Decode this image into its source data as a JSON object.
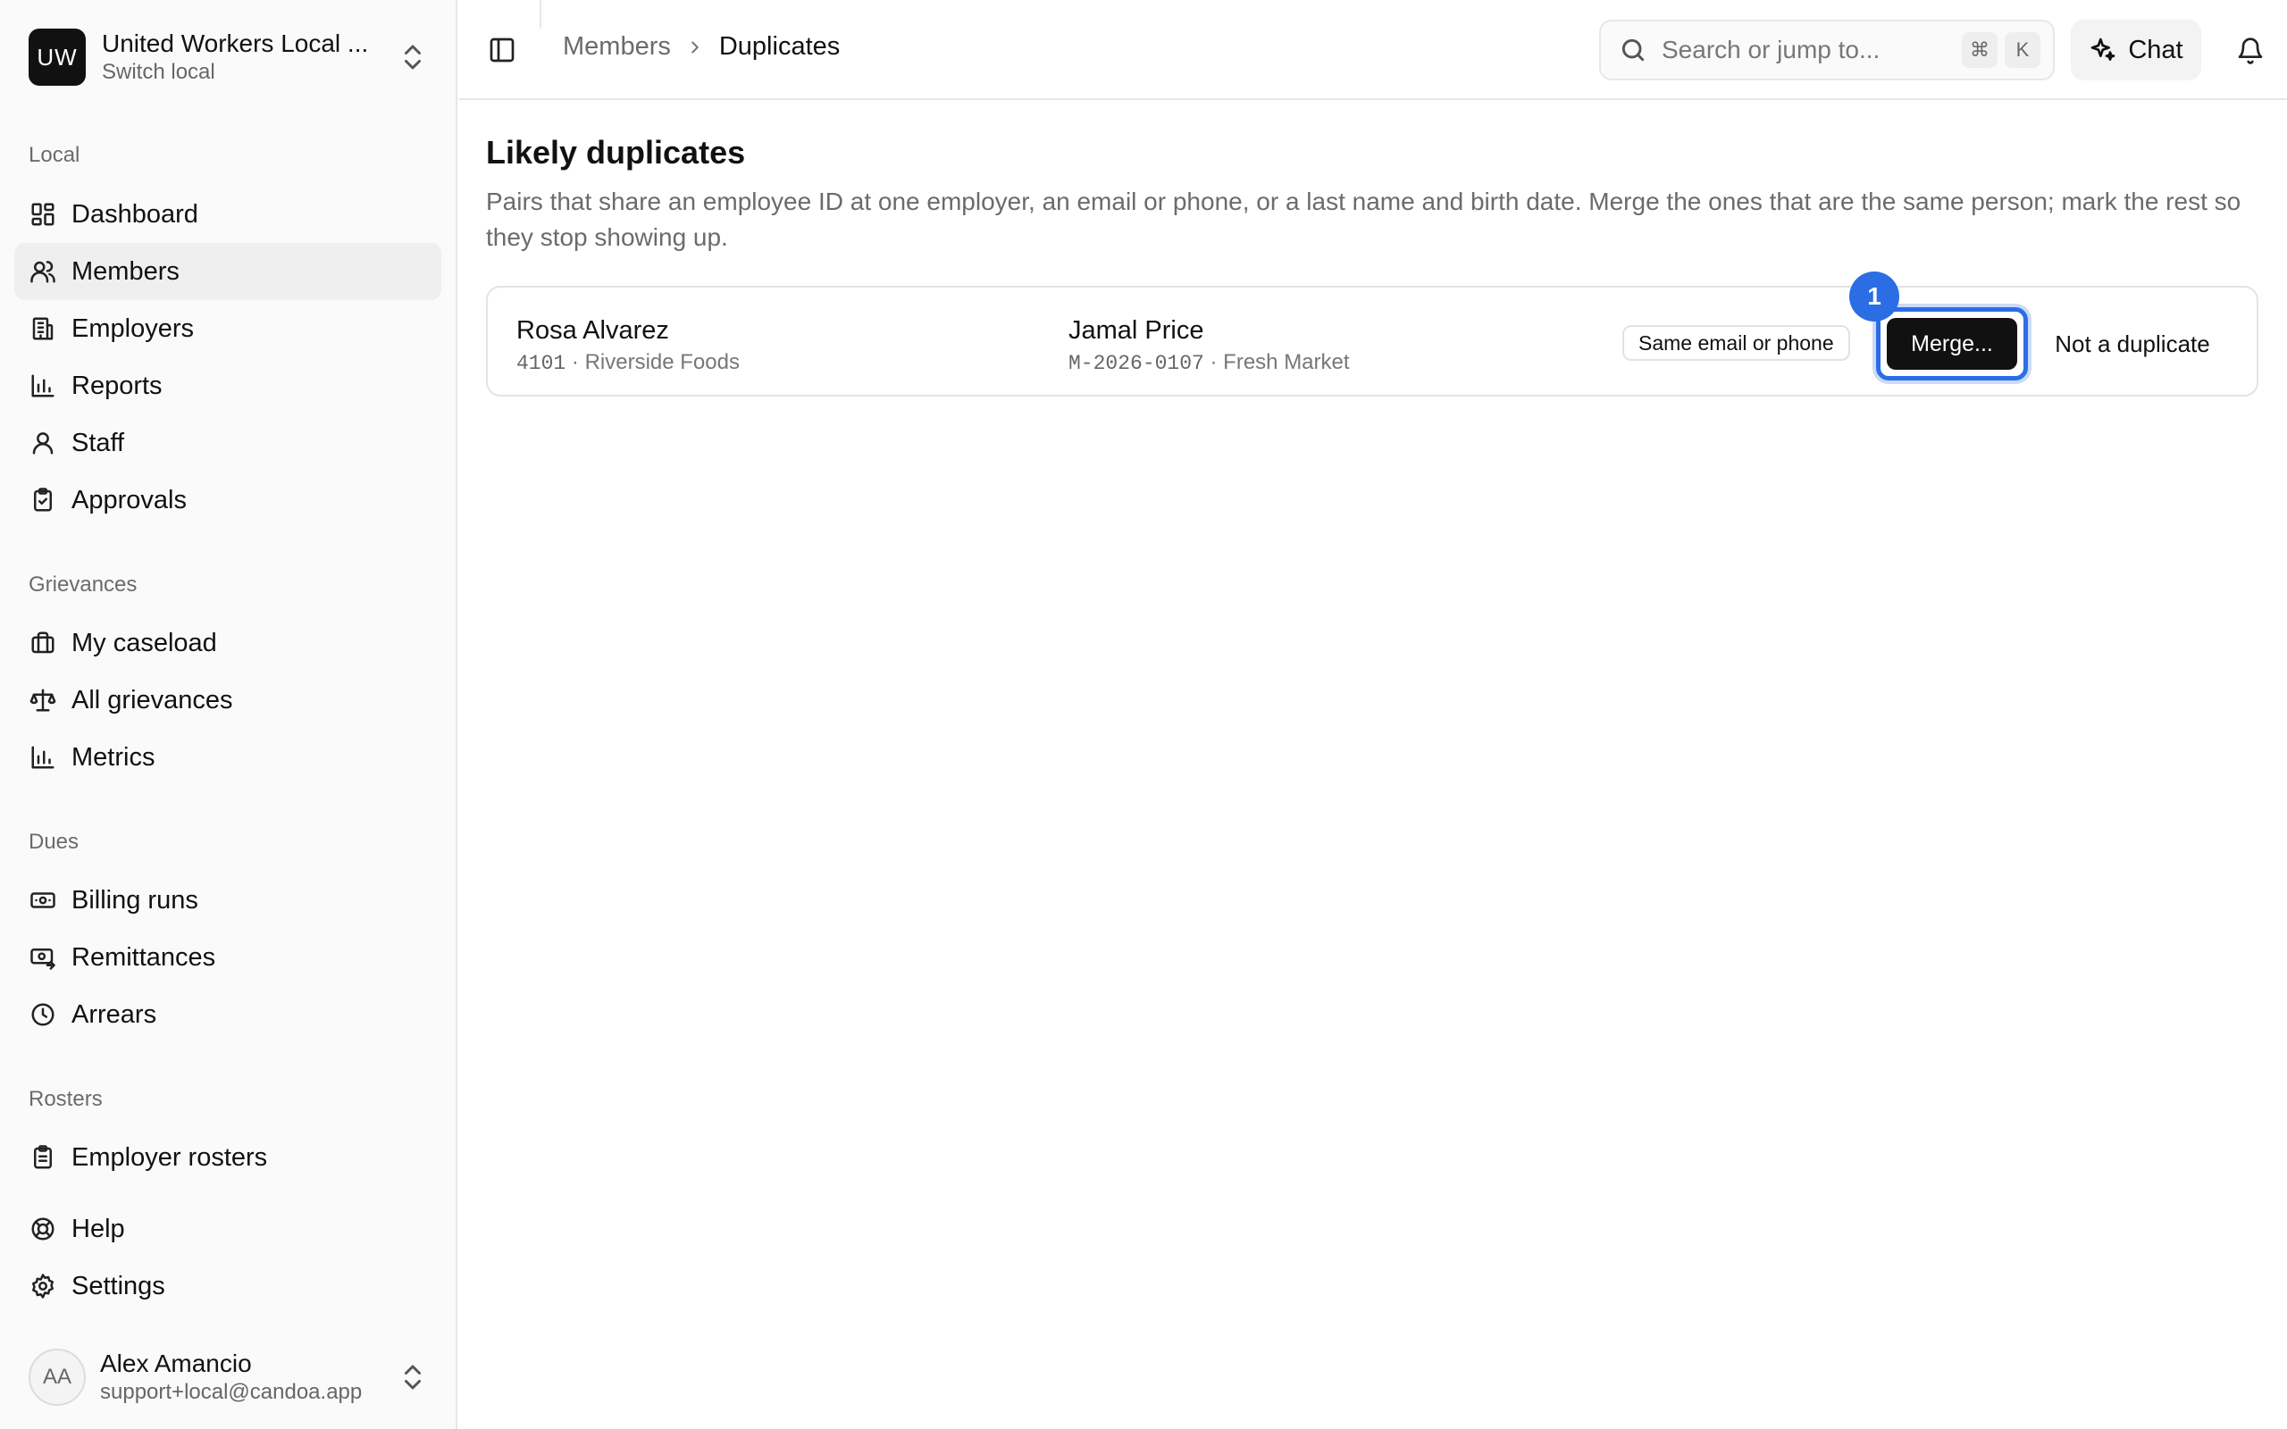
{
  "org": {
    "badge": "UW",
    "name": "United Workers Local ...",
    "sub": "Switch local"
  },
  "sidebar": {
    "sections": [
      {
        "label": "Local",
        "items": [
          {
            "label": "Dashboard",
            "icon": "dashboard-icon"
          },
          {
            "label": "Members",
            "icon": "users-icon",
            "active": true
          },
          {
            "label": "Employers",
            "icon": "building-icon"
          },
          {
            "label": "Reports",
            "icon": "bar-chart-icon"
          },
          {
            "label": "Staff",
            "icon": "user-icon"
          },
          {
            "label": "Approvals",
            "icon": "clipboard-check-icon"
          }
        ]
      },
      {
        "label": "Grievances",
        "items": [
          {
            "label": "My caseload",
            "icon": "briefcase-icon"
          },
          {
            "label": "All grievances",
            "icon": "scale-icon"
          },
          {
            "label": "Metrics",
            "icon": "bar-chart-icon"
          }
        ]
      },
      {
        "label": "Dues",
        "items": [
          {
            "label": "Billing runs",
            "icon": "banknote-icon"
          },
          {
            "label": "Remittances",
            "icon": "remittance-icon"
          },
          {
            "label": "Arrears",
            "icon": "clock-icon"
          }
        ]
      },
      {
        "label": "Rosters",
        "items": [
          {
            "label": "Employer rosters",
            "icon": "clipboard-list-icon"
          }
        ]
      }
    ],
    "footer_items": [
      {
        "label": "Help",
        "icon": "life-buoy-icon"
      },
      {
        "label": "Settings",
        "icon": "gear-icon"
      }
    ]
  },
  "user": {
    "initials": "AA",
    "name": "Alex Amancio",
    "email": "support+local@candoa.app"
  },
  "header": {
    "breadcrumb": {
      "parent": "Members",
      "current": "Duplicates"
    },
    "search": {
      "placeholder": "Search or jump to...",
      "kbd_mod": "⌘",
      "kbd_key": "K"
    },
    "chat_label": "Chat"
  },
  "main": {
    "title": "Likely duplicates",
    "description": "Pairs that share an employee ID at one employer, an email or phone, or a last name and birth date. Merge the ones that are the same person; mark the rest so they stop showing up.",
    "pairs": [
      {
        "a": {
          "name": "Rosa Alvarez",
          "id": "4101",
          "employer": "Riverside Foods"
        },
        "b": {
          "name": "Jamal Price",
          "id": "M-2026-0107",
          "employer": "Fresh Market"
        },
        "reason": "Same email or phone",
        "merge_label": "Merge...",
        "not_dup_label": "Not a duplicate"
      }
    ],
    "marker": "1",
    "meta_sep": "·"
  },
  "colors": {
    "accent": "#2b6de5",
    "primary_button": "#111111"
  }
}
